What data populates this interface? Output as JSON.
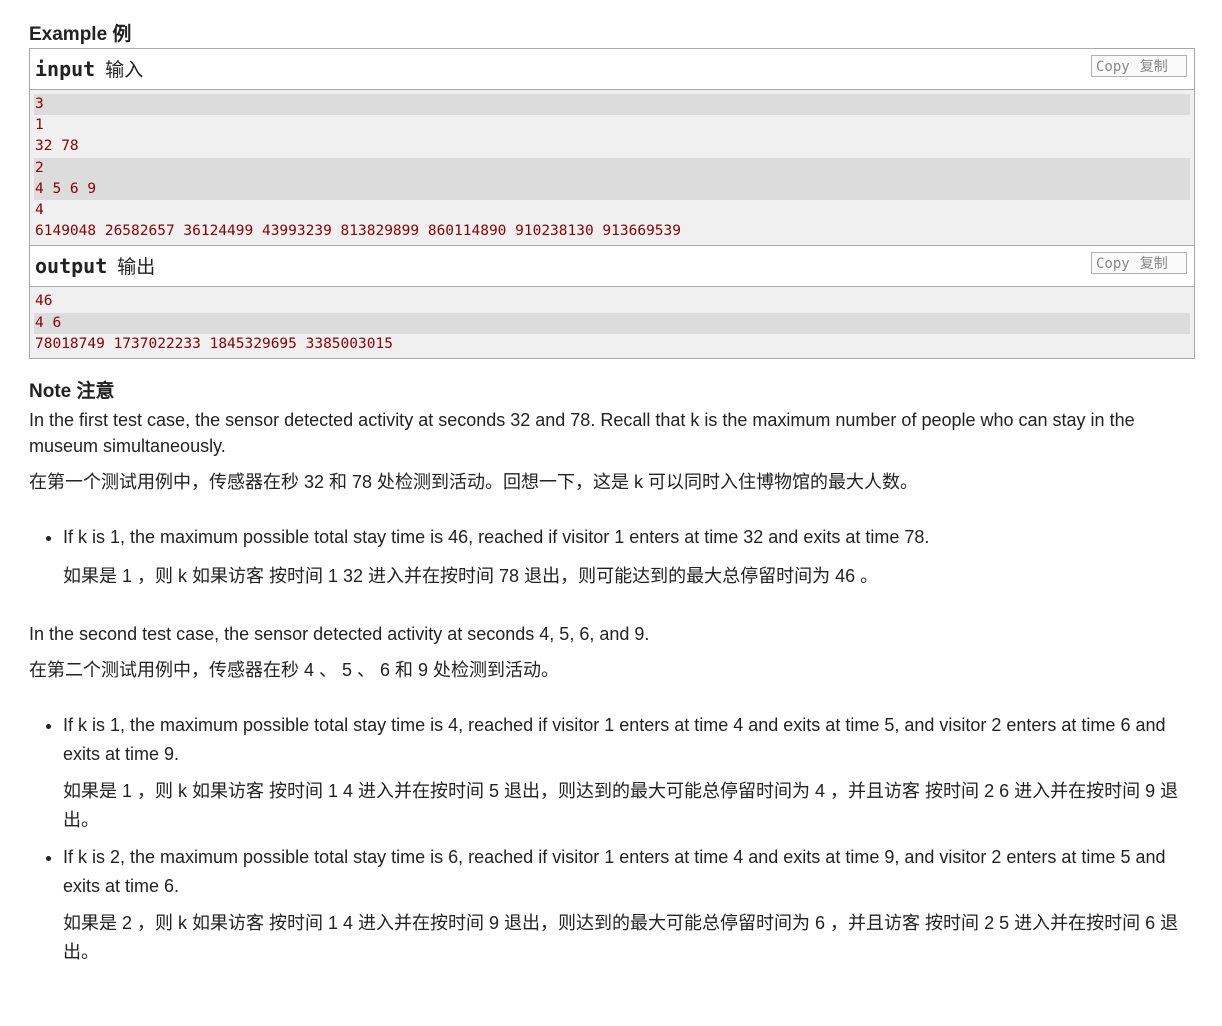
{
  "example_title": "Example 例",
  "input": {
    "label": "input",
    "label_zh": "输入",
    "copy": "Copy",
    "copy_zh": "复制",
    "lines": [
      "3",
      "1",
      "32 78",
      "2",
      "4 5 6 9",
      "4",
      "6149048 26582657 36124499 43993239 813829899 860114890 910238130 913669539"
    ]
  },
  "output": {
    "label": "output",
    "label_zh": "输出",
    "copy": "Copy",
    "copy_zh": "复制",
    "lines": [
      "46",
      "4 6",
      "78018749 1737022233 1845329695 3385003015"
    ]
  },
  "note": {
    "title": "Note 注意",
    "p1": "In the first test case, the sensor detected activity at seconds 32 and 78. Recall that k is the maximum number of people who can stay in the museum simultaneously.",
    "p1_zh": "在第一个测试用例中，传感器在秒 32 和 78 处检测到活动。回想一下，这是 k 可以同时入住博物馆的最大人数。",
    "b1": "If k is 1, the maximum possible total stay time is 46, reached if visitor 1 enters at time 32 and exits at time 78.",
    "b1_zh": "如果是 1 ，则 k 如果访客 按时间 1 32 进入并在按时间 78 退出，则可能达到的最大总停留时间为 46 。",
    "p2": "In the second test case, the sensor detected activity at seconds 4, 5, 6, and 9.",
    "p2_zh": "在第二个测试用例中，传感器在秒 4 、 5 、 6 和 9 处检测到活动。",
    "b2": "If k is 1, the maximum possible total stay time is 4, reached if visitor 1 enters at time 4 and exits at time 5, and visitor 2 enters at time 6 and exits at time 9.",
    "b2_zh": "如果是 1 ，则 k 如果访客 按时间 1 4 进入并在按时间 5 退出，则达到的最大可能总停留时间为 4 ，并且访客 按时间 2 6 进入并在按时间 9 退出。",
    "b3": "If k is 2, the maximum possible total stay time is 6, reached if visitor 1 enters at time 4 and exits at time 9, and visitor 2 enters at time 5 and exits at time 6.",
    "b3_zh": "如果是 2 ，则 k 如果访客 按时间 1 4 进入并在按时间 9 退出，则达到的最大可能总停留时间为 6 ，并且访客 按时间 2 5 进入并在按时间 6 退出。"
  }
}
